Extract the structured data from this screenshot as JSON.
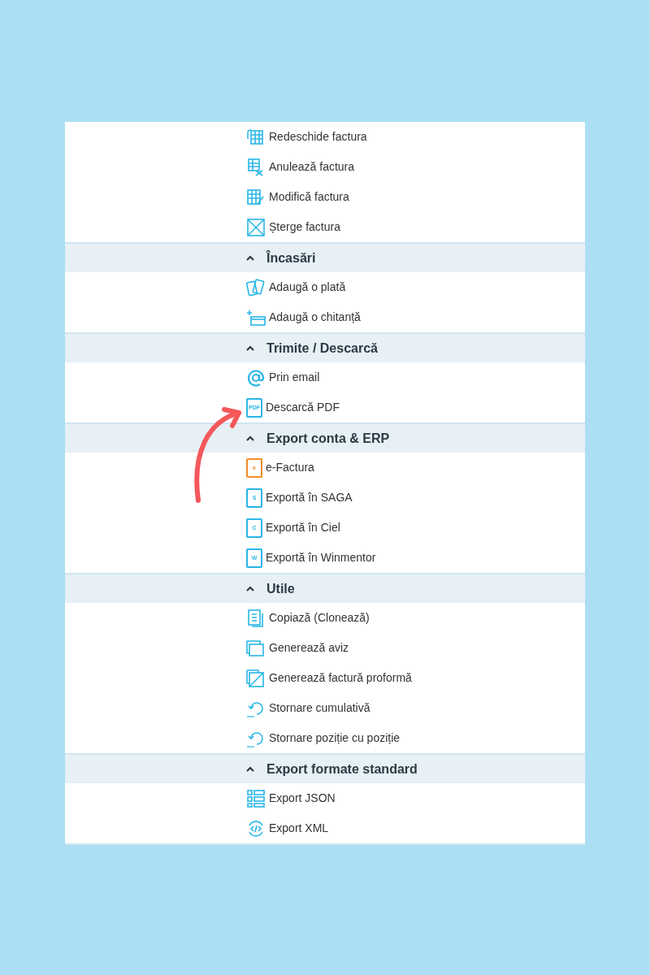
{
  "sections": [
    {
      "items": [
        {
          "label": "Redeschide factura"
        },
        {
          "label": "Anulează factura"
        },
        {
          "label": "Modifică factura"
        },
        {
          "label": "Șterge factura"
        }
      ]
    },
    {
      "title": "Încasări",
      "expanded": true,
      "items": [
        {
          "label": "Adaugă o plată"
        },
        {
          "label": "Adaugă o chitanță"
        }
      ]
    },
    {
      "title": "Trimite / Descarcă",
      "expanded": true,
      "items": [
        {
          "label": "Prin email"
        },
        {
          "label": "Descarcă PDF",
          "icon_text": "PDF",
          "color": "#29b6e6"
        }
      ]
    },
    {
      "title": "Export conta & ERP",
      "expanded": true,
      "items": [
        {
          "label": "e-Factura",
          "icon_text": "e",
          "color": "#f5892a"
        },
        {
          "label": "Exportă în SAGA",
          "icon_text": "S",
          "color": "#29b6e6"
        },
        {
          "label": "Exportă în Ciel",
          "icon_text": "C",
          "color": "#29b6e6"
        },
        {
          "label": "Exportă în Winmentor",
          "icon_text": "W",
          "color": "#29b6e6"
        }
      ]
    },
    {
      "title": "Utile",
      "expanded": true,
      "items": [
        {
          "label": "Copiază (Clonează)"
        },
        {
          "label": "Generează aviz"
        },
        {
          "label": "Generează factură proformă"
        },
        {
          "label": "Stornare cumulativă"
        },
        {
          "label": "Stornare poziție cu poziție"
        }
      ]
    },
    {
      "title": "Export formate standard",
      "expanded": true,
      "items": [
        {
          "label": "Export JSON"
        },
        {
          "label": "Export XML"
        }
      ]
    }
  ]
}
